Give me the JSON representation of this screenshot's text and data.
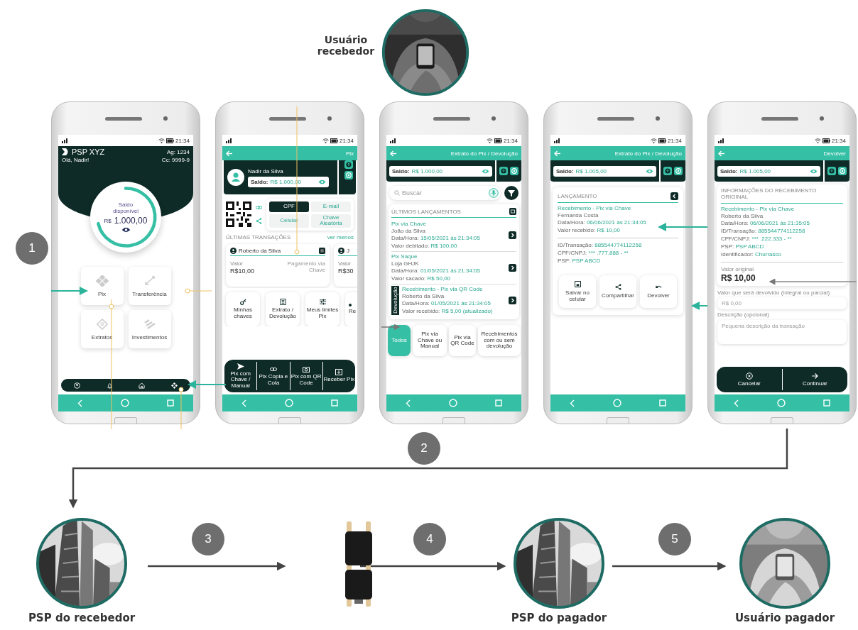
{
  "receiver_user": {
    "label": "Usuário recebedor"
  },
  "steps": [
    "1",
    "2",
    "3",
    "4",
    "5"
  ],
  "phones": [
    {
      "kind": "home",
      "time": "21:34",
      "brand": "PSP XYZ",
      "greeting": "Olá, Nadir!",
      "agency": "Ag: 1234",
      "account": "Cc: 9999-9",
      "balance_label": "Saldo disponível",
      "currency": "R$",
      "balance": "1.000,00",
      "tiles": [
        "Pix",
        "Transferência",
        "Extratos",
        "Investimentos"
      ]
    },
    {
      "kind": "pix",
      "time": "21:34",
      "title": "Pix",
      "name": "Nadir da Silva",
      "balance": {
        "label": "Saldo:",
        "value": "R$ 1.000,00"
      },
      "key_types": [
        {
          "label": "CPF",
          "selected": true
        },
        {
          "label": "E-mail",
          "selected": false
        },
        {
          "label": "Celular",
          "selected": false
        },
        {
          "label": "Chave Aleatória",
          "selected": false
        }
      ],
      "section": "ÚLTIMAS TRANSAÇÕES",
      "section_link": "ver menos",
      "transactions": [
        {
          "name": "Roberto da Silva",
          "value_label": "Valor",
          "value": "R$10,00",
          "type": "Pagamento via Chave"
        },
        {
          "name": "J",
          "value_label": "Valor",
          "value": "R$30"
        }
      ],
      "shortcuts": [
        "Minhas chaves",
        "Extrato / Devolução",
        "Meus limites Pix",
        "Re"
      ],
      "actions": [
        "Pix com Chave / Manual",
        "Pix Copia e Cola",
        "Pix com QR Code",
        "Receber Pix"
      ]
    },
    {
      "kind": "statement",
      "time": "21:34",
      "title": "Extrato do Pix / Devolução",
      "balance": {
        "label": "Saldo:",
        "value": "R$ 1.000,00"
      },
      "search_placeholder": "Buscar",
      "section": "ÚLTIMOS LANÇAMENTOS",
      "entries": [
        {
          "title": "Pix via Chave",
          "name": "João da Silva",
          "rows": [
            {
              "label": "Data/Hora:",
              "value": "15/05/2021 às 21:34:05"
            },
            {
              "label": "Valor debitado:",
              "value": "R$ 100,00"
            }
          ]
        },
        {
          "title": "Pix Saque",
          "name": "Loja GHJK",
          "rows": [
            {
              "label": "Data/Hora:",
              "value": "01/05/2021 às 21:34:05"
            },
            {
              "label": "Valor sacado:",
              "value": "R$ 50,00"
            }
          ]
        },
        {
          "title": "Recebimento - Pix via QR Code",
          "name": "Roberto da Silva",
          "tag": "Devolução",
          "rows": [
            {
              "label": "Data/Hora:",
              "value": "01/05/2021 às 21:34:05"
            },
            {
              "label": "Valor recebido:",
              "value": "R$ 5,00 (atualizado)"
            }
          ]
        }
      ],
      "filters": [
        {
          "label": "Todos",
          "selected": true
        },
        {
          "label": "Pix via Chave ou Manual",
          "selected": false
        },
        {
          "label": "Pix via QR Code",
          "selected": false
        },
        {
          "label": "Recebimentos com ou sem devolução",
          "selected": false
        }
      ]
    },
    {
      "kind": "entry",
      "time": "21:34",
      "title": "Extrato do Pix / Devolução",
      "balance": {
        "label": "Saldo:",
        "value": "R$ 1.005,00"
      },
      "section": "LANÇAMENTO",
      "entry_title": "Recebimento - Pix via Chave",
      "name": "Fernanda Costa",
      "rows": [
        {
          "label": "Data/Hora:",
          "value": "06/06/2021 às 21:34:05"
        },
        {
          "label": "Valor recebido:",
          "value": "R$ 10,00"
        }
      ],
      "details": [
        {
          "label": "ID/Transação:",
          "value": "885544774112258"
        },
        {
          "label": "CPF/CNPJ:",
          "value": "*** .777.888 - **"
        },
        {
          "label": "PSP:",
          "value": "PSP ABCD"
        }
      ],
      "actions": [
        {
          "kind": "save",
          "label": "Salvar no celular"
        },
        {
          "kind": "share",
          "label": "Compartilhar"
        },
        {
          "kind": "undo",
          "label": "Devolver"
        }
      ]
    },
    {
      "kind": "refund",
      "time": "21:34",
      "title": "Devolver",
      "balance": {
        "label": "Saldo:",
        "value": "R$ 1.005,00"
      },
      "section": "INFORMAÇÕES DO RECEBIMENTO ORIGINAL",
      "entry_title": "Recebimento - Pix via Chave",
      "name": "Roberto da Silva",
      "rows": [
        {
          "label": "Data/Hora:",
          "value": "06/06/2021 às 21:35:05"
        },
        {
          "label": "ID/Transação:",
          "value": "885544774112258"
        },
        {
          "label": "CPF/CNPJ:",
          "value": "*** .222.333 - **"
        },
        {
          "label": "PSP:",
          "value": "PSP ABCD"
        },
        {
          "label": "Identificador:",
          "value": "Churrasco"
        }
      ],
      "original_label": "Valor original",
      "original_value": "R$ 10,00",
      "amount_label": "Valor que será devolvido (integral ou parcial)",
      "amount_placeholder": "R$ 0,00",
      "description_label": "Descrição (opcional)",
      "description_placeholder": "Pequena descrição da transação",
      "buttons": [
        {
          "kind": "cancel",
          "label": "Cancelar"
        },
        {
          "kind": "continue",
          "label": "Continuar"
        }
      ]
    }
  ],
  "flow": [
    {
      "kind": "bank",
      "label": "PSP do recebedor"
    },
    {
      "kind": "rack"
    },
    {
      "kind": "bank",
      "label": "PSP do pagador"
    },
    {
      "kind": "user",
      "label": "Usuário pagador"
    }
  ]
}
